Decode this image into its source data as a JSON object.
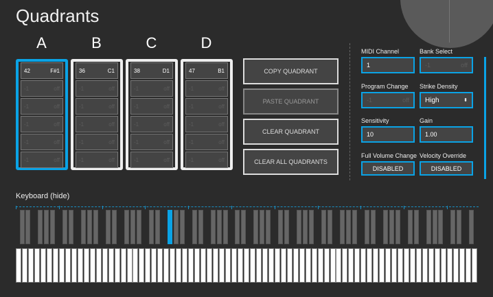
{
  "title": "Quadrants",
  "quadrants": [
    {
      "label": "A",
      "selected": true,
      "first": {
        "value": "42",
        "note": "F#1"
      },
      "rows": [
        {
          "value": "-1",
          "note": "off"
        },
        {
          "value": "-1",
          "note": "off"
        },
        {
          "value": "-1",
          "note": "off"
        },
        {
          "value": "-1",
          "note": "off"
        },
        {
          "value": "-1",
          "note": "off"
        }
      ]
    },
    {
      "label": "B",
      "selected": false,
      "first": {
        "value": "36",
        "note": "C1"
      },
      "rows": [
        {
          "value": "-1",
          "note": "off"
        },
        {
          "value": "-1",
          "note": "off"
        },
        {
          "value": "-1",
          "note": "off"
        },
        {
          "value": "-1",
          "note": "off"
        },
        {
          "value": "-1",
          "note": "off"
        }
      ]
    },
    {
      "label": "C",
      "selected": false,
      "first": {
        "value": "38",
        "note": "D1"
      },
      "rows": [
        {
          "value": "-1",
          "note": "off"
        },
        {
          "value": "-1",
          "note": "off"
        },
        {
          "value": "-1",
          "note": "off"
        },
        {
          "value": "-1",
          "note": "off"
        },
        {
          "value": "-1",
          "note": "off"
        }
      ]
    },
    {
      "label": "D",
      "selected": false,
      "first": {
        "value": "47",
        "note": "B1"
      },
      "rows": [
        {
          "value": "-1",
          "note": "off"
        },
        {
          "value": "-1",
          "note": "off"
        },
        {
          "value": "-1",
          "note": "off"
        },
        {
          "value": "-1",
          "note": "off"
        },
        {
          "value": "-1",
          "note": "off"
        }
      ]
    }
  ],
  "buttons": {
    "copy": "COPY QUADRANT",
    "paste": "PASTE QUADRANT",
    "clear": "CLEAR QUADRANT",
    "clear_all": "CLEAR ALL QUADRANTS"
  },
  "settings": {
    "midi_channel": {
      "label": "MIDI Channel",
      "value": "1"
    },
    "bank_select": {
      "label": "Bank Select",
      "value": "-1",
      "note": "off"
    },
    "program_change": {
      "label": "Program Change",
      "value": "-1",
      "note": "off"
    },
    "strike_density": {
      "label": "Strike Density",
      "value": "High"
    },
    "sensitivity": {
      "label": "Sensitivity",
      "value": "10"
    },
    "gain": {
      "label": "Gain",
      "value": "1.00"
    },
    "full_volume_change": {
      "label": "Full Volume Change",
      "value": "DISABLED"
    },
    "velocity_override": {
      "label": "Velocity Override",
      "value": "DISABLED"
    }
  },
  "keyboard": {
    "label": "Keyboard (hide)",
    "white_keys": 75,
    "highlighted_black_key_index": 17
  },
  "colors": {
    "accent": "#0aa3e6",
    "background": "#2b2b2b"
  }
}
